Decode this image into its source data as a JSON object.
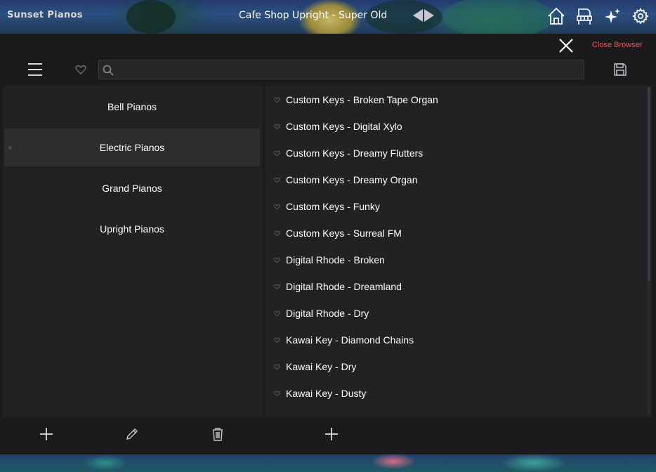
{
  "header": {
    "app_title": "Sunset Pianos",
    "preset_title": "Cafe Shop Upright - Super Old",
    "icons": [
      "home-icon",
      "piano-icon",
      "sparkles-icon",
      "gear-icon"
    ]
  },
  "browser": {
    "close_label": "Close Browser",
    "search": {
      "value": "",
      "placeholder": ""
    }
  },
  "categories": [
    {
      "label": "Bell Pianos",
      "selected": false
    },
    {
      "label": "Electric Pianos",
      "selected": true
    },
    {
      "label": "Grand Pianos",
      "selected": false
    },
    {
      "label": "Upright Pianos",
      "selected": false
    }
  ],
  "presets": [
    "Custom Keys - Broken Tape Organ",
    "Custom Keys - Digital Xylo",
    "Custom Keys - Dreamy Flutters",
    "Custom Keys - Dreamy Organ",
    "Custom Keys - Funky",
    "Custom Keys - Surreal FM",
    "Digital Rhode - Broken",
    "Digital Rhode - Dreamland",
    "Digital Rhode - Dry",
    "Kawai Key - Diamond Chains",
    "Kawai Key - Dry",
    "Kawai Key - Dusty"
  ],
  "colors": {
    "accent_red": "#e0595b",
    "panel": "#222124",
    "background": "#1b1a1c",
    "selected": "#2d2c2f"
  }
}
